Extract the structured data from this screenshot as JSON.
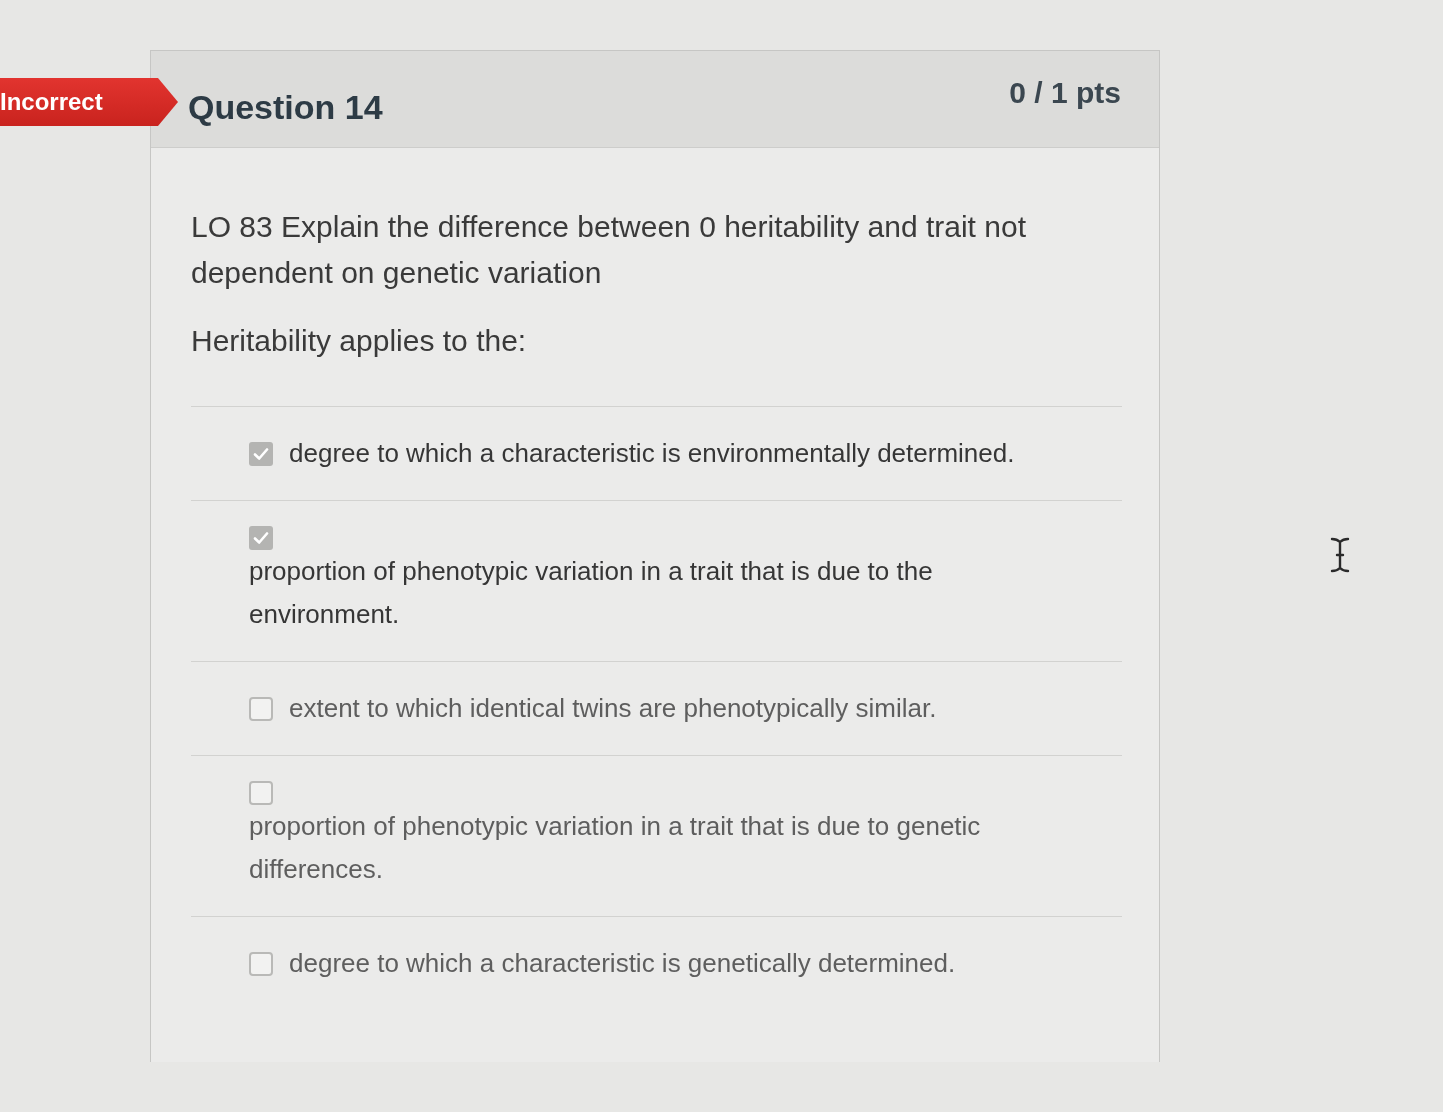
{
  "question": {
    "status": "Incorrect",
    "title": "Question 14",
    "points": "0 / 1 pts"
  },
  "prompt": [
    "LO 83 Explain the difference between 0 heritability and trait not dependent on genetic variation",
    "Heritability applies to the:"
  ],
  "answers": [
    {
      "text": "degree to which a characteristic is environmentally determined.",
      "checked": true
    },
    {
      "text": "proportion of phenotypic variation in a trait that is due to the environment.",
      "checked": true
    },
    {
      "text": "extent to which identical twins are phenotypically similar.",
      "checked": false
    },
    {
      "text": "proportion of phenotypic variation in a trait that is due to genetic differences.",
      "checked": false
    },
    {
      "text": "degree to which a characteristic is genetically determined.",
      "checked": false
    }
  ]
}
